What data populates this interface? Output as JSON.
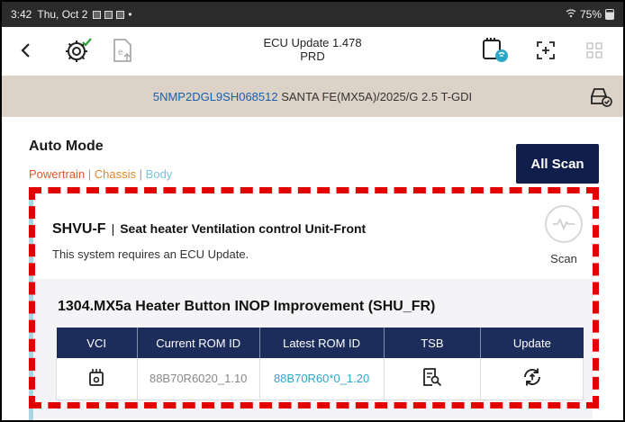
{
  "status_bar": {
    "time": "3:42",
    "date": "Thu, Oct 2",
    "battery": "75%"
  },
  "app_bar": {
    "title_line1": "ECU Update 1.478",
    "title_line2": "PRD"
  },
  "vehicle": {
    "vin": "5NMP2DGL9SH068512",
    "description": "SANTA FE(MX5A)/2025/G 2.5 T-GDI"
  },
  "auto_mode": {
    "heading": "Auto Mode",
    "tabs": [
      "Powertrain",
      "Chassis",
      "Body"
    ],
    "separator": "|",
    "all_scan_label": "All Scan"
  },
  "system": {
    "code": "SHVU-F",
    "separator": "|",
    "name": "Seat heater Ventilation control Unit-Front",
    "message": "This system requires an ECU Update.",
    "scan_label": "Scan"
  },
  "tsb": {
    "title": "1304.MX5a Heater Button INOP Improvement (SHU_FR)",
    "columns": [
      "VCI",
      "Current ROM ID",
      "Latest ROM ID",
      "TSB",
      "Update"
    ],
    "row": {
      "current_rom": "88B70R6020_1.10",
      "latest_rom": "88B70R60*0_1.20"
    }
  },
  "colors": {
    "header_navy": "#1c2c5b",
    "all_scan_bg": "#0f1e4a",
    "vin_bar_bg": "#dcd2c8",
    "powertrain": "#e0572a",
    "latest_rom": "#2ba8c9",
    "highlight_dash": "#e30000"
  }
}
